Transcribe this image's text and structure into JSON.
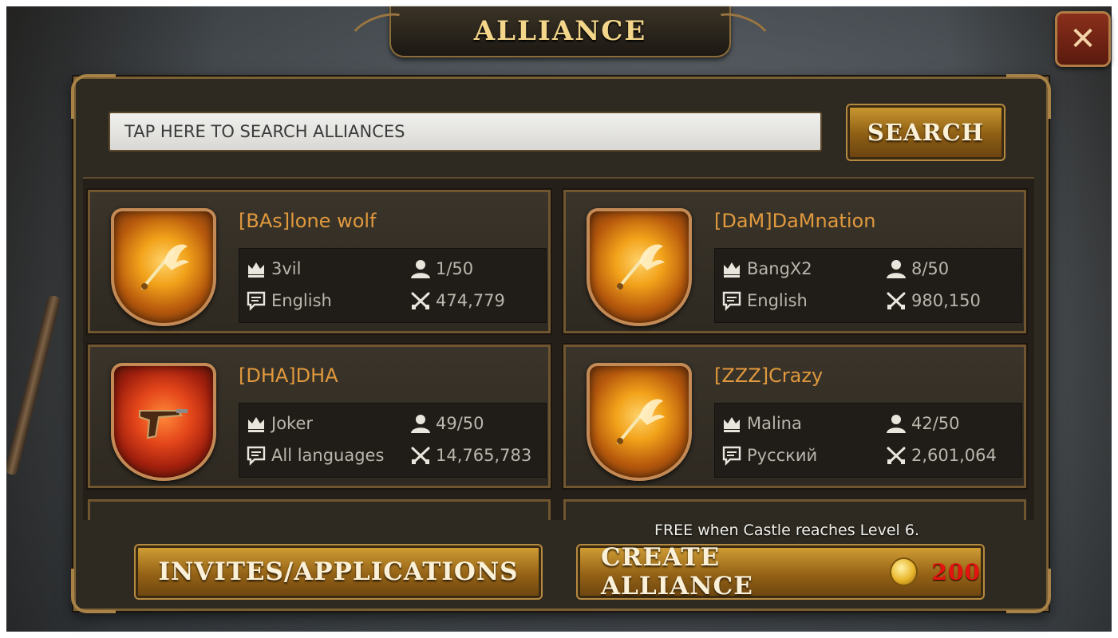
{
  "header": {
    "title": "ALLIANCE",
    "close_label": "✕"
  },
  "search": {
    "placeholder": "TAP HERE TO SEARCH ALLIANCES",
    "button_label": "SEARCH"
  },
  "alliances": [
    {
      "name": "[BAs]lone wolf",
      "leader": "3vil",
      "language": "English",
      "members": "1/50",
      "power": "474,779",
      "badge": "winged-sword-icon"
    },
    {
      "name": "[DaM]DaMnation",
      "leader": "BangX2",
      "language": "English",
      "members": "8/50",
      "power": "980,150",
      "badge": "winged-sword-icon"
    },
    {
      "name": "[DHA]DHA",
      "leader": "Joker",
      "language": "All languages",
      "members": "49/50",
      "power": "14,765,783",
      "badge": "pistol-icon"
    },
    {
      "name": "[ZZZ]Crazy",
      "leader": "Malina",
      "language": "Русский",
      "members": "42/50",
      "power": "2,601,064",
      "badge": "winged-sword-icon"
    }
  ],
  "footer": {
    "invites_label": "INVITES/APPLICATIONS",
    "create_label": "CREATE ALLIANCE",
    "create_cost": "200",
    "free_note": "FREE when Castle reaches Level 6."
  },
  "colors": {
    "accent_gold": "#e0993d",
    "cost_red": "#e3140f",
    "button_gold": "#cf9c34"
  }
}
